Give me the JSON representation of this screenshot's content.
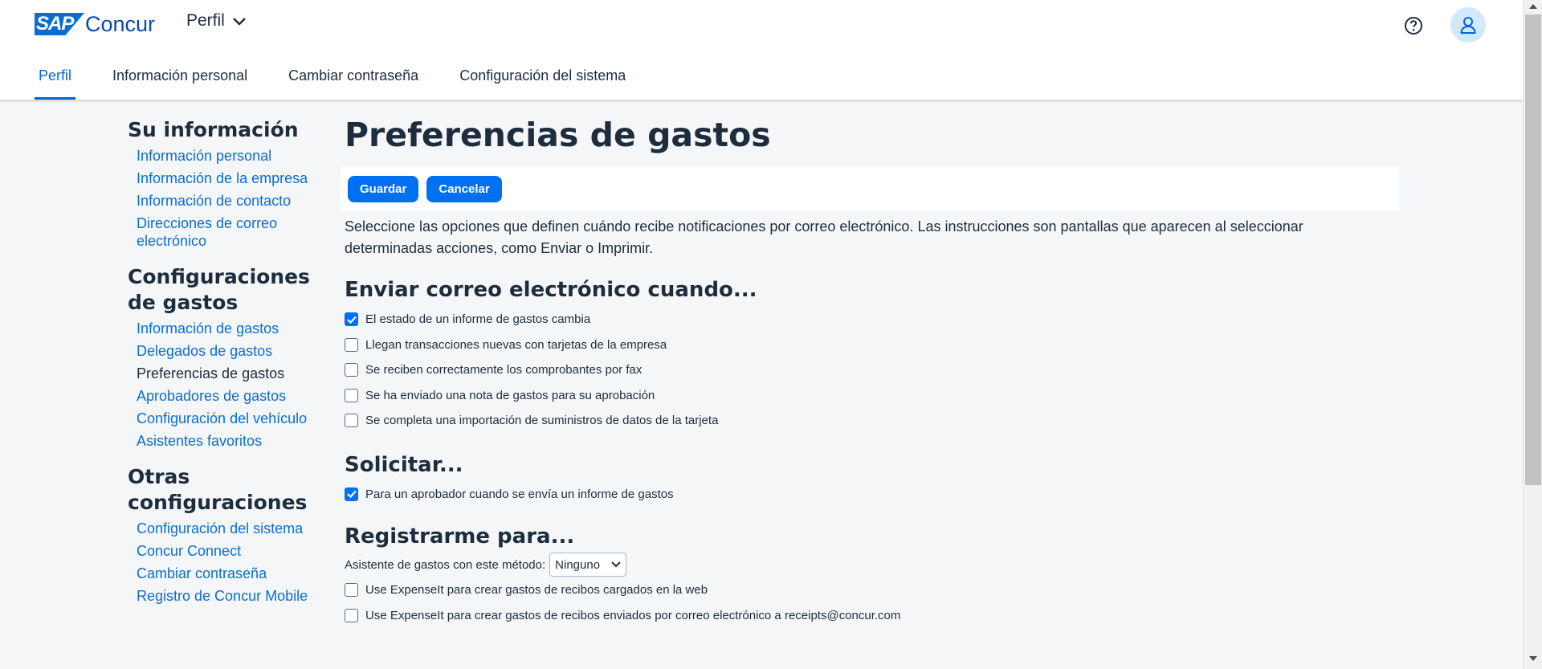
{
  "header": {
    "logo_sap": "SAP",
    "logo_concur": "Concur",
    "app_switch_label": "Perfil",
    "tabs": [
      {
        "label": "Perfil"
      },
      {
        "label": "Información personal"
      },
      {
        "label": "Cambiar contraseña"
      },
      {
        "label": "Configuración del sistema"
      }
    ]
  },
  "sidebar": {
    "sections": [
      {
        "title": "Su información",
        "items": [
          "Información personal",
          "Información de la empresa",
          "Información de contacto",
          "Direcciones de correo electrónico"
        ]
      },
      {
        "title": "Configuraciones de gastos",
        "items": [
          "Información de gastos",
          "Delegados de gastos",
          "Preferencias de gastos",
          "Aprobadores de gastos",
          "Configuración del vehículo",
          "Asistentes favoritos"
        ]
      },
      {
        "title": "Otras configuraciones",
        "items": [
          "Configuración del sistema",
          "Concur Connect",
          "Cambiar contraseña",
          "Registro de Concur Mobile"
        ]
      }
    ],
    "current_item": "Preferencias de gastos"
  },
  "main": {
    "title": "Preferencias de gastos",
    "save_label": "Guardar",
    "cancel_label": "Cancelar",
    "intro": "Seleccione las opciones que definen cuándo recibe notificaciones por correo electrónico. Las instrucciones son pantallas que aparecen al seleccionar determinadas acciones, como Enviar o Imprimir.",
    "email_section": {
      "title": "Enviar correo electrónico cuando...",
      "options": [
        {
          "label": "El estado de un informe de gastos cambia",
          "checked": true
        },
        {
          "label": "Llegan transacciones nuevas con tarjetas de la empresa",
          "checked": false
        },
        {
          "label": "Se reciben correctamente los comprobantes por fax",
          "checked": false
        },
        {
          "label": "Se ha enviado una nota de gastos para su aprobación",
          "checked": false
        },
        {
          "label": "Se completa una importación de suministros de datos de la tarjeta",
          "checked": false
        }
      ]
    },
    "request_section": {
      "title": "Solicitar...",
      "options": [
        {
          "label": "Para un aprobador cuando se envía un informe de gastos",
          "checked": true
        }
      ]
    },
    "register_section": {
      "title": "Registrarme para...",
      "select_label": "Asistente de gastos con este método:",
      "select_value": "Ninguno",
      "options": [
        {
          "label": "Use ExpenseIt para crear gastos de recibos cargados en la web",
          "checked": false
        },
        {
          "label": "Use ExpenseIt para crear gastos de recibos enviados por correo electrónico a receipts@concur.com",
          "checked": false
        }
      ]
    }
  },
  "colors": {
    "primary": "#0070f2",
    "link": "#0a6ed1",
    "text": "#1d2d3e",
    "background": "#f5f6f7"
  },
  "icons": [
    "chevron-down-icon",
    "help-icon",
    "user-icon",
    "checkmark-icon"
  ]
}
